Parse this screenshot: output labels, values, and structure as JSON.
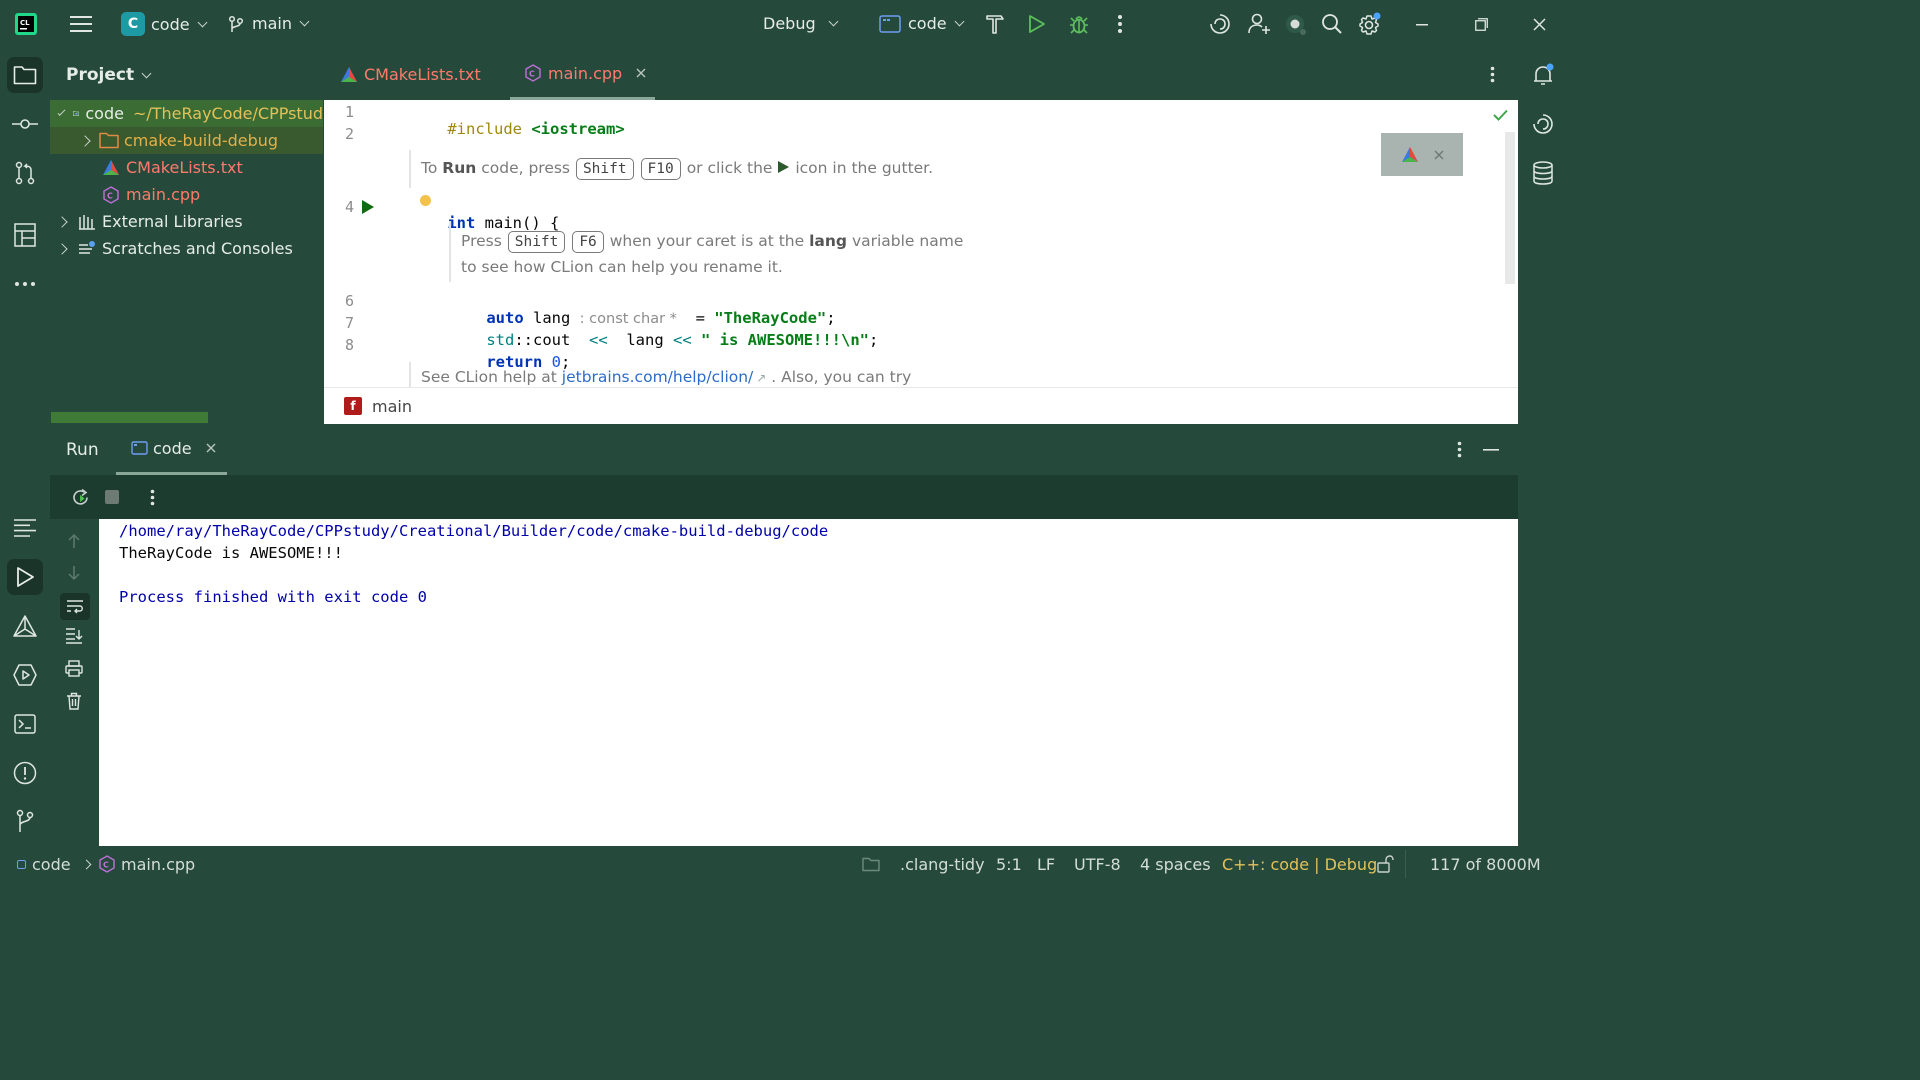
{
  "titlebar": {
    "project_badge": "C",
    "project_name": "code",
    "branch": "main",
    "run_config": "Debug",
    "target": "code"
  },
  "project_panel": {
    "title": "Project",
    "tree": [
      {
        "label": "code",
        "path": "~/TheRayCode/CPPstud",
        "level": 0,
        "expanded": true,
        "icon": "folder-icon"
      },
      {
        "label": "cmake-build-debug",
        "level": 1,
        "expanded": false,
        "icon": "folder-icon",
        "color": "#e2b04a"
      },
      {
        "label": "CMakeLists.txt",
        "level": 1,
        "icon": "cmake-icon",
        "color": "#ff7a6b"
      },
      {
        "label": "main.cpp",
        "level": 1,
        "icon": "cpp-file-icon",
        "color": "#ff7a6b"
      },
      {
        "label": "External Libraries",
        "level": 0,
        "expanded": false,
        "icon": "library-icon"
      },
      {
        "label": "Scratches and Consoles",
        "level": 0,
        "expanded": false,
        "icon": "scratches-icon"
      }
    ]
  },
  "editor": {
    "tabs": [
      {
        "label": "CMakeLists.txt",
        "color": "#ff7a6b",
        "active": false
      },
      {
        "label": "main.cpp",
        "color": "#ff7a6b",
        "active": true
      }
    ],
    "line_numbers": [
      "1",
      "2",
      "4",
      "6",
      "7",
      "8"
    ],
    "code": {
      "include_kw": "#include",
      "include_target": "<iostream>",
      "main_type": "int",
      "main_rest": " main() {",
      "auto_kw": "auto",
      "lang_var": " lang",
      "type_hint": ": const char *",
      "assign": "  = ",
      "str_value": "\"TheRayCode\"",
      "semi": ";",
      "std_ns": "std",
      "scope_cout": "::cout ",
      "shift1": "<<",
      "lang_ref": "  lang ",
      "shift2": "<<",
      "str2": "\" is AWESOME!!!\\n\"",
      "return_kw": "return",
      "zero": "0",
      "semi2": ";"
    },
    "doc1": {
      "pre": "To",
      "run": "Run",
      "mid": "code, press",
      "key1": "Shift",
      "key2": "F10",
      "post1": "or click the",
      "post2": "icon in the gutter."
    },
    "doc2": {
      "pre": "Press",
      "key1": "Shift",
      "key2": "F6",
      "mid": "when your caret is at the",
      "var": "lang",
      "post": "variable name",
      "line2": "to see how CLion can help you rename it."
    },
    "doc3": {
      "pre": "See CLion help at",
      "link": "jetbrains.com/help/clion/",
      "post": ". Also, you can try"
    },
    "breadcrumb_fn_badge": "f",
    "breadcrumb": "main"
  },
  "run_panel": {
    "title": "Run",
    "tab": "code",
    "output": [
      {
        "text": "/home/ray/TheRayCode/CPPstudy/Creational/Builder/code/cmake-build-debug/code",
        "color": "#0000aa"
      },
      {
        "text": "TheRayCode is AWESOME!!!",
        "color": "#080808"
      },
      {
        "text": "",
        "color": "#080808"
      },
      {
        "text": "Process finished with exit code 0",
        "color": "#0000aa"
      }
    ]
  },
  "statusbar": {
    "crumb_project": "code",
    "crumb_file": "main.cpp",
    "linter": ".clang-tidy",
    "caret": "5:1",
    "line_sep": "LF",
    "encoding": "UTF-8",
    "indent": "4 spaces",
    "context": "C++: code | Debug",
    "memory": "117 of 8000M"
  },
  "colors": {
    "chrome": "#254a3c",
    "selection": "#3b6c34",
    "accent_green": "#4fc34f",
    "file_red": "#ff7a6b",
    "status_context": "#e2c15a"
  }
}
